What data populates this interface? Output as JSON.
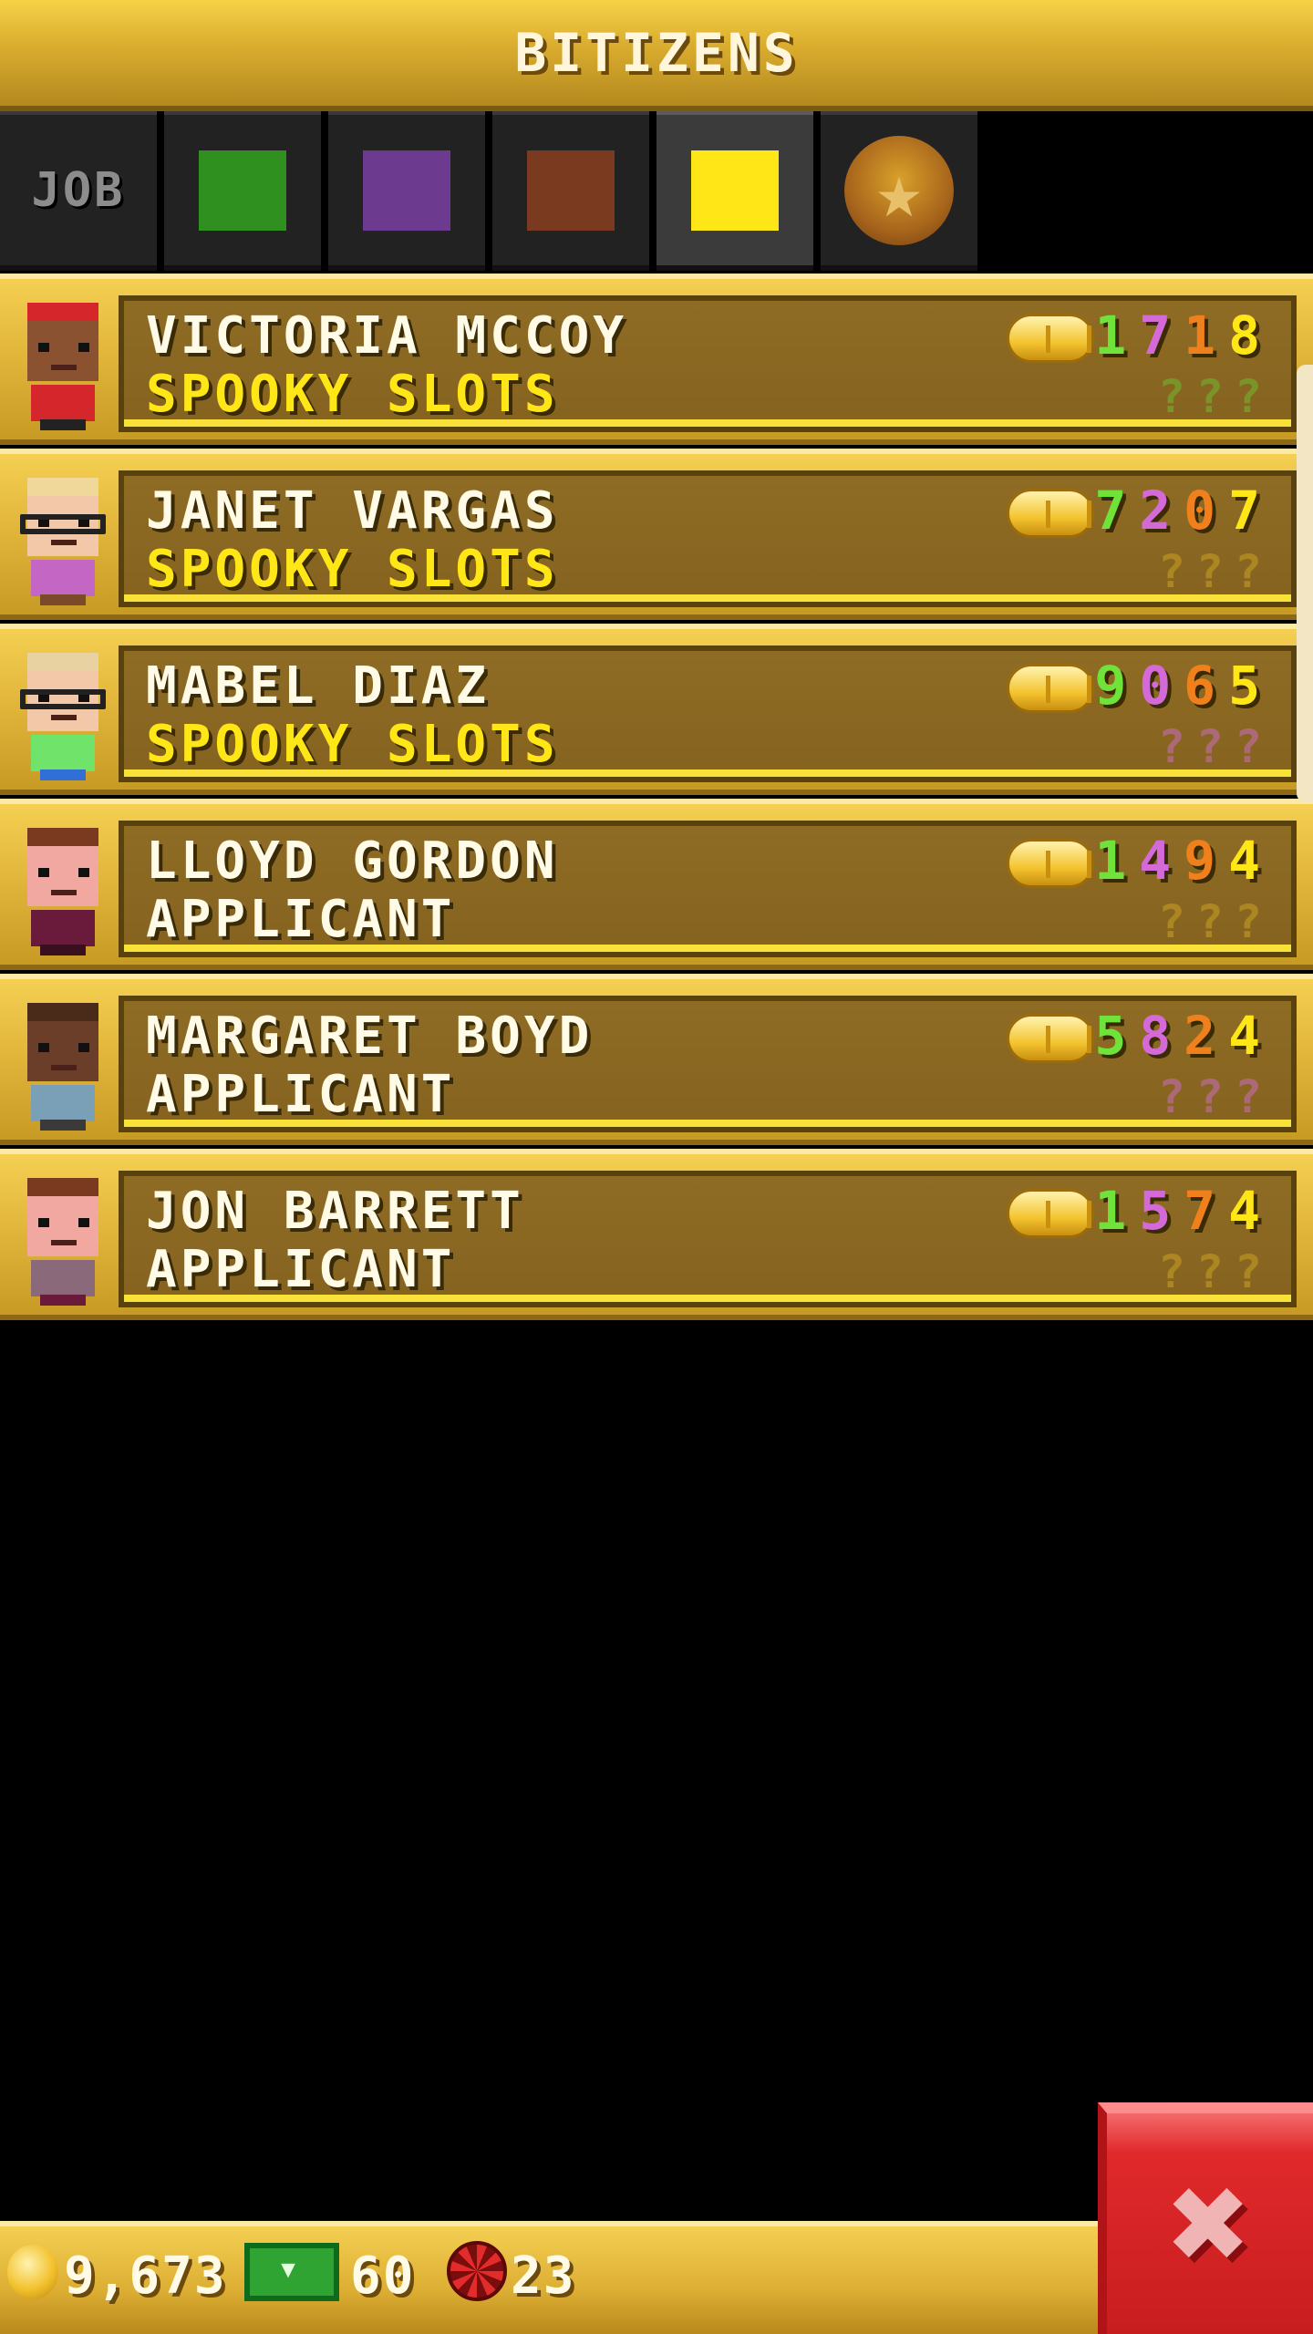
{
  "header": {
    "title": "BITIZENS"
  },
  "tabs": [
    {
      "kind": "label",
      "label": "JOB",
      "active": false
    },
    {
      "kind": "color",
      "color": "#2f8f1f",
      "active": false
    },
    {
      "kind": "color",
      "color": "#6c3a8f",
      "active": false
    },
    {
      "kind": "color",
      "color": "#7a3a1f",
      "active": false
    },
    {
      "kind": "color",
      "color": "#ffe617",
      "active": true
    },
    {
      "kind": "icon",
      "icon": "star-badge-icon",
      "active": false
    }
  ],
  "bitizens": [
    {
      "name": "VICTORIA MCCOY",
      "job": "SPOOKY SLOTS",
      "job_style": "spooky",
      "skills": [
        "1",
        "7",
        "1",
        "8"
      ],
      "skill_colors": [
        "green",
        "pink",
        "orange",
        "yellow"
      ],
      "unknown": "???",
      "unknown_color": "green",
      "avatar": {
        "hair": "#d4262b",
        "skin": "#8a5230",
        "body": "#d4262b",
        "legs": "#222",
        "glasses": false
      }
    },
    {
      "name": "JANET VARGAS",
      "job": "SPOOKY SLOTS",
      "job_style": "spooky",
      "skills": [
        "7",
        "2",
        "0",
        "7"
      ],
      "skill_colors": [
        "green",
        "pink",
        "orange",
        "yellow"
      ],
      "unknown": "???",
      "unknown_color": "brown",
      "avatar": {
        "hair": "#f0d79a",
        "skin": "#f2c8a8",
        "body": "#c467c4",
        "legs": "#7a4a2a",
        "glasses": true
      }
    },
    {
      "name": "MABEL DIAZ",
      "job": "SPOOKY SLOTS",
      "job_style": "spooky",
      "skills": [
        "9",
        "0",
        "6",
        "5"
      ],
      "skill_colors": [
        "green",
        "pink",
        "orange",
        "yellow"
      ],
      "unknown": "???",
      "unknown_color": "pink",
      "avatar": {
        "hair": "#e8d2a2",
        "skin": "#f2c8a8",
        "body": "#6fe36a",
        "legs": "#2f6fd6",
        "glasses": true
      }
    },
    {
      "name": "LLOYD GORDON",
      "job": "APPLICANT",
      "job_style": "applicant",
      "skills": [
        "1",
        "4",
        "9",
        "4"
      ],
      "skill_colors": [
        "green",
        "pink",
        "orange",
        "yellow"
      ],
      "unknown": "???",
      "unknown_color": "brown",
      "avatar": {
        "hair": "#7a3a20",
        "skin": "#f0a8a0",
        "body": "#6a1a3a",
        "legs": "#3a1020",
        "glasses": false
      }
    },
    {
      "name": "MARGARET BOYD",
      "job": "APPLICANT",
      "job_style": "applicant",
      "skills": [
        "5",
        "8",
        "2",
        "4"
      ],
      "skill_colors": [
        "green",
        "pink",
        "orange",
        "yellow"
      ],
      "unknown": "???",
      "unknown_color": "pink",
      "avatar": {
        "hair": "#4a2a18",
        "skin": "#6a3e28",
        "body": "#7aa0b8",
        "legs": "#3a3a3a",
        "glasses": false
      }
    },
    {
      "name": "JON BARRETT",
      "job": "APPLICANT",
      "job_style": "applicant",
      "skills": [
        "1",
        "5",
        "7",
        "4"
      ],
      "skill_colors": [
        "green",
        "pink",
        "orange",
        "yellow"
      ],
      "unknown": "???",
      "unknown_color": "brown",
      "avatar": {
        "hair": "#7a3a20",
        "skin": "#f0a8a0",
        "body": "#8a6a7a",
        "legs": "#6a1a3a",
        "glasses": false
      }
    }
  ],
  "footer": {
    "coins": "9,673",
    "bux": "60",
    "chips": "23"
  },
  "close_button": {
    "icon": "close-x-icon"
  }
}
